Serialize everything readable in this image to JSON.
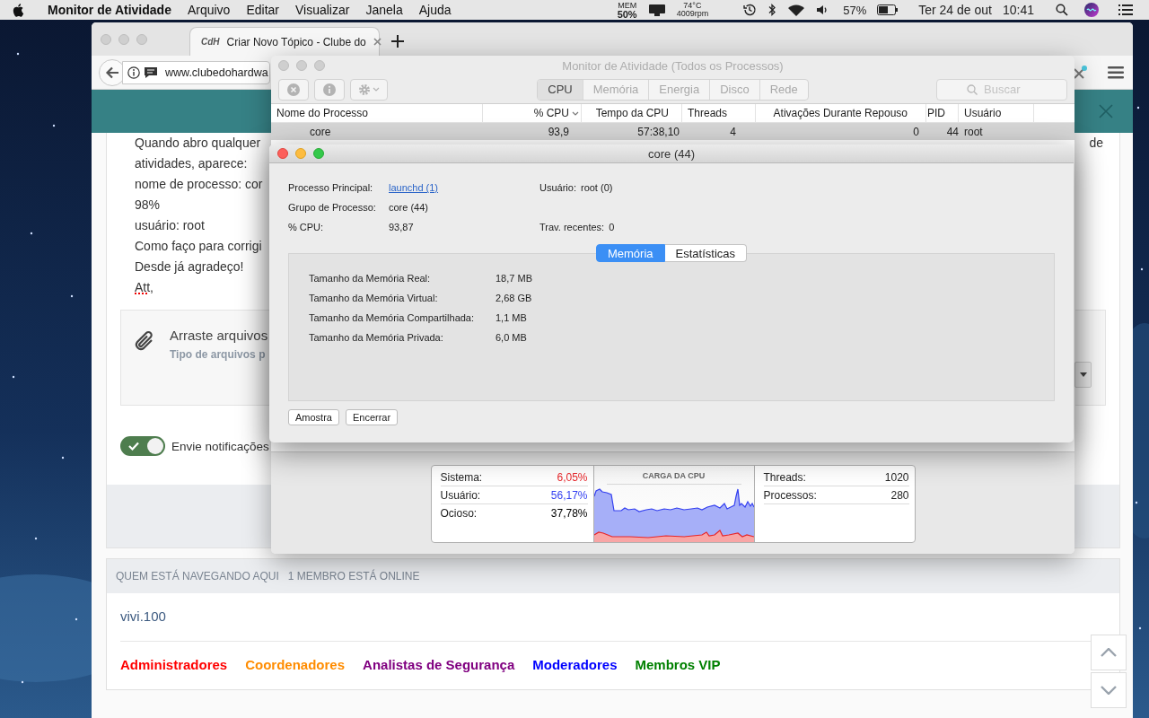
{
  "menu_bar": {
    "app": "Monitor de Atividade",
    "menus": [
      "Arquivo",
      "Editar",
      "Visualizar",
      "Janela",
      "Ajuda"
    ],
    "mem_label": "MEM",
    "mem_value": "50%",
    "temperature": "74°C",
    "fan_speed": "4009rpm",
    "battery_percent": "57%",
    "date": "Ter 24 de out",
    "time": "10:41"
  },
  "browser": {
    "tab": {
      "logo": "CdH",
      "title": "Criar Novo Tópico - Clube do"
    },
    "url": "www.clubedohardwa",
    "post": {
      "lines": [
        "Quando abro qualquer",
        "atividades, aparece:",
        "nome de processo: cor",
        "98%",
        "usuário: root",
        "Como faço para corrigi",
        "Desde já agradeço!",
        "Att,"
      ],
      "first_line_end": "de"
    },
    "attach": {
      "title": "Arraste arquivos",
      "hint": "Tipo de arquivos p"
    },
    "notify": {
      "label": "Envie notificações",
      "on": true
    },
    "online": {
      "header": "QUEM ESTÁ NAVEGANDO AQUI",
      "count": "1 MEMBRO ESTÁ ONLINE",
      "members": [
        "vivi.100"
      ],
      "groups": [
        {
          "name": "Administradores",
          "color": "#ff0000"
        },
        {
          "name": "Coordenadores",
          "color": "#ff8c00"
        },
        {
          "name": "Analistas de Segurança",
          "color": "#800080"
        },
        {
          "name": "Moderadores",
          "color": "#0000ff"
        },
        {
          "name": "Membros VIP",
          "color": "#008000"
        }
      ]
    }
  },
  "activity_monitor": {
    "title": "Monitor de Atividade (Todos os Processos)",
    "tabs": [
      {
        "label": "CPU",
        "selected": true
      },
      {
        "label": "Memória",
        "selected": false
      },
      {
        "label": "Energia",
        "selected": false
      },
      {
        "label": "Disco",
        "selected": false
      },
      {
        "label": "Rede",
        "selected": false
      }
    ],
    "search": {
      "placeholder": "Buscar"
    },
    "columns": [
      {
        "label": "Nome do Processo",
        "sorted": false
      },
      {
        "label": "% CPU",
        "sorted": true
      },
      {
        "label": "Tempo da CPU",
        "sorted": false
      },
      {
        "label": "Threads",
        "sorted": false
      },
      {
        "label": "Ativações Durante Repouso",
        "sorted": false
      },
      {
        "label": "PID",
        "sorted": false
      },
      {
        "label": "Usuário",
        "sorted": false
      }
    ],
    "rows": [
      {
        "cells": [
          "core",
          "93,9",
          "57:38,10",
          "4",
          "0",
          "44",
          "root"
        ],
        "selected": true
      }
    ],
    "cpu_stats": [
      {
        "label": "Sistema:",
        "value": "6,05%",
        "color": "#e8262a"
      },
      {
        "label": "Usuário:",
        "value": "56,17%",
        "color": "#3440f0"
      },
      {
        "label": "Ocioso:",
        "value": "37,78%",
        "color": "#000000"
      }
    ],
    "graph_title": "CARGA DA CPU",
    "counts": [
      {
        "label": "Threads:",
        "value": "1020"
      },
      {
        "label": "Processos:",
        "value": "280"
      }
    ]
  },
  "process_dialog": {
    "title": "core (44)",
    "rows": [
      {
        "label": "Processo Principal:",
        "value": "launchd (1)",
        "kind": "link",
        "right_label": "Usuário:",
        "right_value": "root (0)"
      },
      {
        "label": "Grupo de Processo:",
        "value": "core (44)",
        "kind": "text"
      },
      {
        "label": "% CPU:",
        "value": "93,87",
        "kind": "text",
        "right_label": "Trav. recentes:",
        "right_value": "0"
      }
    ],
    "tabs": [
      {
        "label": "Memória",
        "selected": true
      },
      {
        "label": "Estatísticas",
        "selected": false
      }
    ],
    "memory": [
      {
        "label": "Tamanho da Memória Real:",
        "value": "18,7 MB"
      },
      {
        "label": "Tamanho da Memória Virtual:",
        "value": "2,68 GB"
      },
      {
        "label": "Tamanho da Memória Compartilhada:",
        "value": "1,1 MB"
      },
      {
        "label": "Tamanho da Memória Privada:",
        "value": "6,0 MB"
      }
    ],
    "buttons": [
      "Amostra",
      "Encerrar"
    ]
  }
}
